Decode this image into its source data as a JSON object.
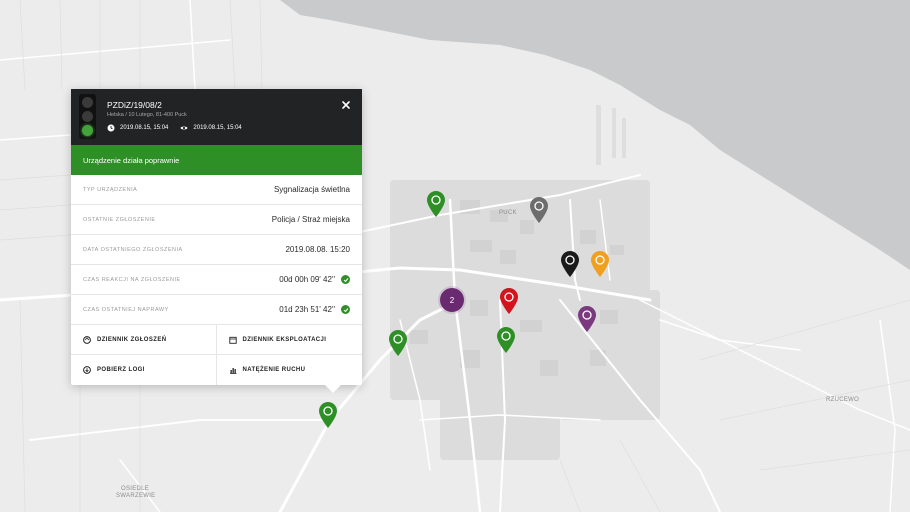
{
  "map": {
    "labels": {
      "puck": "PUCK",
      "rzucewo": "RZUCEWO",
      "osiedle": "OSIEDLE",
      "swarzewie": "SWARZEWIE"
    },
    "markers": [
      {
        "name": "marker-green",
        "color": "#2f8f27"
      },
      {
        "name": "marker-gray",
        "color": "#6d6d6d"
      },
      {
        "name": "marker-black",
        "color": "#1a1a1a"
      },
      {
        "name": "marker-orange",
        "color": "#f0a01e"
      },
      {
        "name": "marker-red",
        "color": "#d2141c"
      },
      {
        "name": "marker-purple",
        "color": "#7b3a80"
      }
    ],
    "cluster": {
      "count": "2",
      "color": "#6a2a6f"
    }
  },
  "popup": {
    "title": "PZDiZ/19/08/2",
    "address": "Helska / 10 Lutego, 81-400 Puck",
    "timestamp_clock": "2019.08.15, 15:04",
    "timestamp_view": "2019.08.15, 15:04",
    "status": "Urządzenie działa poprawnie",
    "status_color": "#2f8f27",
    "rows": [
      {
        "label": "Typ urządzenia",
        "value": "Sygnalizacja świetlna"
      },
      {
        "label": "Ostatnie zgłoszenie",
        "value": "Policja / Straż miejska"
      },
      {
        "label": "Data ostatniego zgłoszenia",
        "value": "2019.08.08. 15:20"
      },
      {
        "label": "Czas reakcji na zgłoszenie",
        "value": "00d 00h 09' 42''"
      },
      {
        "label": "Czas ostatniej naprawy",
        "value": "01d 23h 51' 42''"
      }
    ],
    "actions": {
      "reports_log": "Dziennik zgłoszeń",
      "operation_log": "Dziennik eksploatacji",
      "download_logs": "Pobierz logi",
      "traffic": "Natężenie ruchu"
    },
    "icons": {
      "close": "close-icon",
      "clock": "clock-icon",
      "eye": "eye-icon",
      "check": "check-icon"
    }
  }
}
